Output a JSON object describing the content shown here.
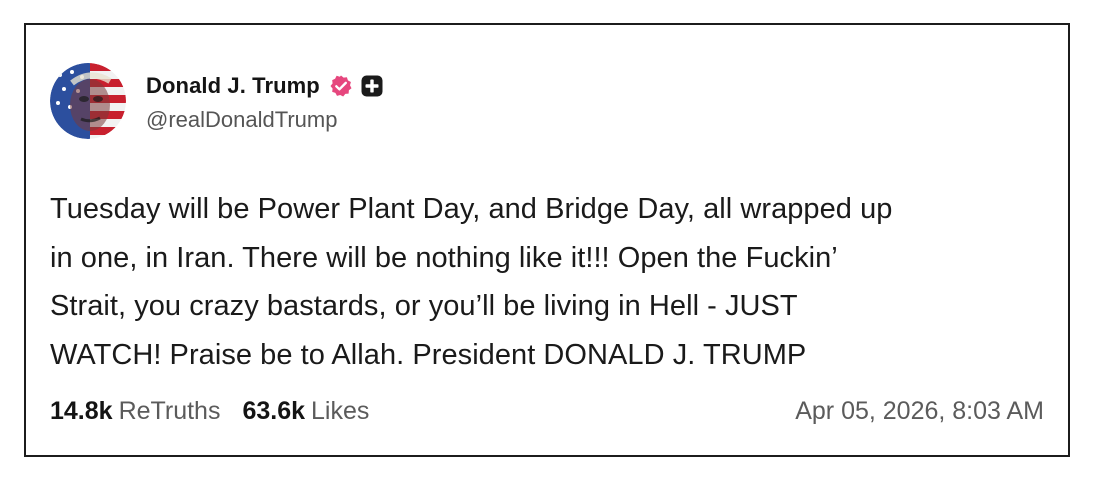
{
  "post": {
    "author": {
      "display_name": "Donald J. Trump",
      "handle": "@realDonaldTrump",
      "avatar_icon": "flag-portrait-avatar",
      "verified_icon": "verified-badge-icon",
      "plus_icon": "plus-badge-icon",
      "verified_color": "#e6477e"
    },
    "body_lines": [
      "Tuesday will be Power Plant Day, and Bridge Day, all wrapped up",
      "in one, in Iran. There will be nothing like it!!! Open the Fuckin’",
      "Strait, you crazy bastards, or you’ll be living in Hell - JUST",
      "WATCH! Praise be to Allah. President DONALD J. TRUMP"
    ],
    "stats": {
      "retruths_count": "14.8k",
      "retruths_label": "ReTruths",
      "likes_count": "63.6k",
      "likes_label": "Likes"
    },
    "timestamp": "Apr 05, 2026, 8:03 AM"
  }
}
